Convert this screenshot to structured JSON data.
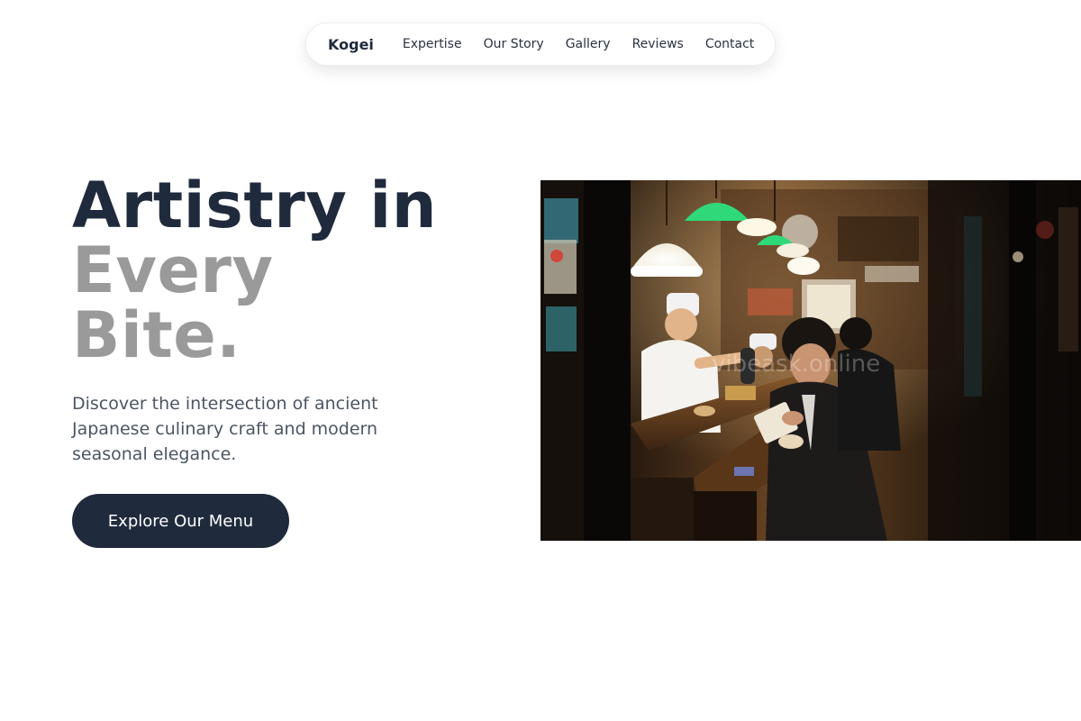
{
  "nav": {
    "brand": "Kogei",
    "links": [
      "Expertise",
      "Our Story",
      "Gallery",
      "Reviews",
      "Contact"
    ]
  },
  "hero": {
    "headline_line1": "Artistry in",
    "headline_line2": "Every",
    "headline_line3": "Bite.",
    "subtitle": "Discover the intersection of ancient Japanese culinary craft and modern seasonal elegance.",
    "cta_label": "Explore Our Menu",
    "image_watermark": "vibeask.online"
  },
  "colors": {
    "primary": "#1f2a3d",
    "muted_heading": "#9a9a9a",
    "body_text": "#4b5563",
    "background": "#ffffff"
  }
}
